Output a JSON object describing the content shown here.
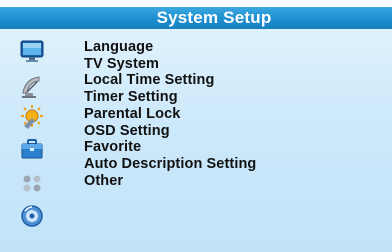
{
  "header": {
    "title": "System Setup"
  },
  "menu": {
    "items": [
      {
        "label": "Language"
      },
      {
        "label": "TV System"
      },
      {
        "label": "Local Time Setting"
      },
      {
        "label": "Timer Setting"
      },
      {
        "label": "Parental Lock"
      },
      {
        "label": "OSD Setting"
      },
      {
        "label": "Favorite"
      },
      {
        "label": "Auto Description Setting"
      },
      {
        "label": "Other"
      }
    ]
  },
  "icons": [
    {
      "name": "tv-monitor-icon"
    },
    {
      "name": "satellite-dish-icon"
    },
    {
      "name": "system-setup-icon"
    },
    {
      "name": "toolbox-icon"
    },
    {
      "name": "game-controller-icon"
    },
    {
      "name": "media-disc-icon"
    }
  ],
  "colors": {
    "title_bar": "#1f8fcf",
    "title_text": "#ffffff",
    "menu_background": "#cde9fb",
    "menu_text": "#111111"
  }
}
